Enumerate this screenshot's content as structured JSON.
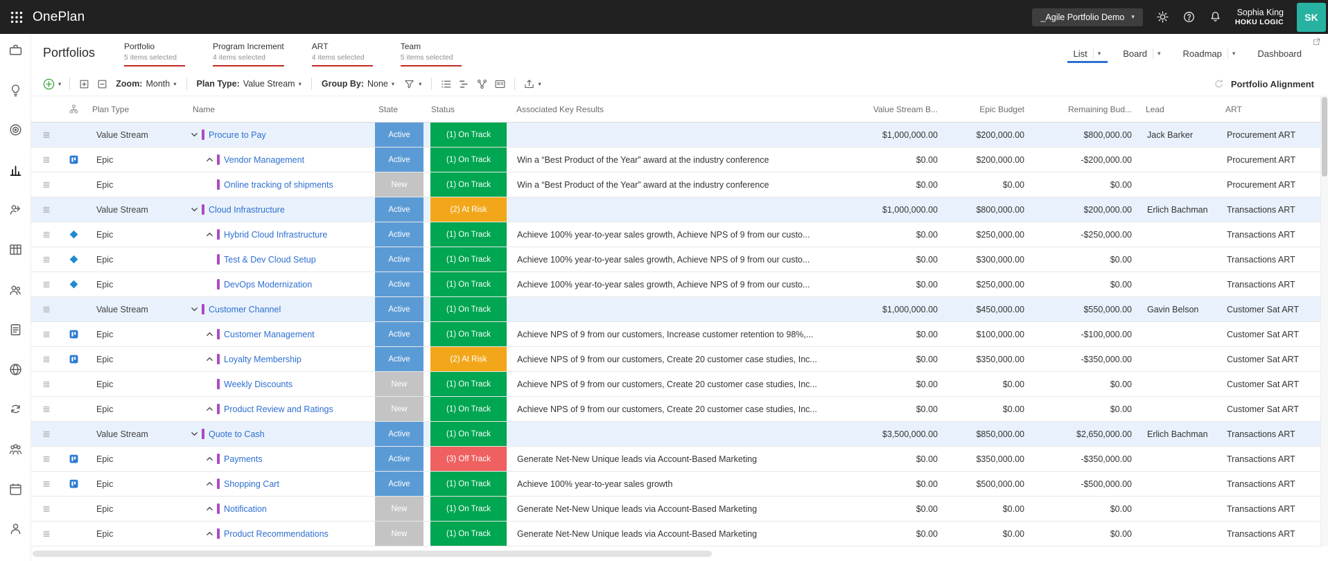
{
  "colors": {
    "topbar_bg": "#212121",
    "accent_blue": "#2e6fd0",
    "filter_underline_red": "#c12a23",
    "value_stream_row_bg": "#e9f2fc",
    "name_bar_purple": "#a94cc3",
    "avatar_teal": "#27b2a2"
  },
  "topbar": {
    "app_title": "OnePlan",
    "workspace_selector": "_Agile Portfolio Demo",
    "user_name": "Sophia King",
    "user_org": "HOKU LOGIC",
    "avatar_initials": "SK"
  },
  "sidebar": {
    "items": [
      {
        "id": "portfolios",
        "icon": "briefcase",
        "active": false
      },
      {
        "id": "ideas",
        "icon": "bulb",
        "active": false
      },
      {
        "id": "goals",
        "icon": "target",
        "active": false
      },
      {
        "id": "insights",
        "icon": "chart",
        "active": true
      },
      {
        "id": "resources",
        "icon": "peopleshare",
        "active": false
      },
      {
        "id": "grid",
        "icon": "table",
        "active": false
      },
      {
        "id": "teams",
        "icon": "people",
        "active": false
      },
      {
        "id": "backlog",
        "icon": "clipboard",
        "active": false
      },
      {
        "id": "network",
        "icon": "globe",
        "active": false
      },
      {
        "id": "processes",
        "icon": "sync",
        "active": false
      },
      {
        "id": "groups",
        "icon": "group",
        "active": false
      },
      {
        "id": "roadmap",
        "icon": "calendar",
        "active": false
      },
      {
        "id": "profile",
        "icon": "person",
        "active": false
      }
    ]
  },
  "page": {
    "title": "Portfolios",
    "filters": [
      {
        "label": "Portfolio",
        "sublabel": "5 items selected"
      },
      {
        "label": "Program Increment",
        "sublabel": "4 items selected"
      },
      {
        "label": "ART",
        "sublabel": "4 items selected"
      },
      {
        "label": "Team",
        "sublabel": "5 items selected"
      }
    ],
    "views": [
      {
        "label": "List",
        "caret": true,
        "active": true
      },
      {
        "label": "Board",
        "caret": true,
        "active": false
      },
      {
        "label": "Roadmap",
        "caret": true,
        "active": false
      },
      {
        "label": "Dashboard",
        "caret": false,
        "active": false
      }
    ]
  },
  "toolbar": {
    "zoom": {
      "label": "Zoom:",
      "value": "Month"
    },
    "plan_type": {
      "label": "Plan Type:",
      "value": "Value Stream"
    },
    "group_by": {
      "label": "Group By:",
      "value": "None"
    },
    "right_text": "Portfolio Alignment"
  },
  "table": {
    "columns": [
      "Plan Type",
      "Name",
      "State",
      "Status",
      "Associated Key Results",
      "Value Stream B...",
      "Epic Budget",
      "Remaining Bud...",
      "Lead",
      "ART"
    ],
    "state_colors": {
      "Active": "#5b9bd5",
      "New": "#c4c4c4"
    },
    "status_colors": {
      "(1) On Track": "#00a651",
      "(2) At Risk": "#f2a71b",
      "(3) Off Track": "#ee6160"
    },
    "rows": [
      {
        "type": "Value Stream",
        "integration": "",
        "caret": "down",
        "name": "Procure to Pay",
        "state": "Active",
        "status": "(1) On Track",
        "key_results": "",
        "value_stream_budget": "$1,000,000.00",
        "epic_budget": "$200,000.00",
        "remaining_budget": "$800,000.00",
        "lead": "Jack Barker",
        "art": "Procurement ART"
      },
      {
        "type": "Epic",
        "integration": "jira",
        "caret": "up",
        "name": "Vendor Management",
        "state": "Active",
        "status": "(1) On Track",
        "key_results": "Win a “Best Product of the Year” award at the industry conference",
        "value_stream_budget": "$0.00",
        "epic_budget": "$200,000.00",
        "remaining_budget": "-$200,000.00",
        "lead": "",
        "art": "Procurement ART"
      },
      {
        "type": "Epic",
        "integration": "",
        "caret": "",
        "name": "Online tracking of shipments",
        "state": "New",
        "status": "(1) On Track",
        "key_results": "Win a “Best Product of the Year” award at the industry conference",
        "value_stream_budget": "$0.00",
        "epic_budget": "$0.00",
        "remaining_budget": "$0.00",
        "lead": "",
        "art": "Procurement ART"
      },
      {
        "type": "Value Stream",
        "integration": "",
        "caret": "down",
        "name": "Cloud Infrastructure",
        "state": "Active",
        "status": "(2) At Risk",
        "key_results": "",
        "value_stream_budget": "$1,000,000.00",
        "epic_budget": "$800,000.00",
        "remaining_budget": "$200,000.00",
        "lead": "Erlich Bachman",
        "art": "Transactions ART"
      },
      {
        "type": "Epic",
        "integration": "azure",
        "caret": "up",
        "name": "Hybrid Cloud Infrastructure",
        "state": "Active",
        "status": "(1) On Track",
        "key_results": "Achieve 100% year-to-year sales growth, Achieve NPS of 9 from our custo...",
        "value_stream_budget": "$0.00",
        "epic_budget": "$250,000.00",
        "remaining_budget": "-$250,000.00",
        "lead": "",
        "art": "Transactions ART"
      },
      {
        "type": "Epic",
        "integration": "azure",
        "caret": "",
        "name": "Test & Dev Cloud Setup",
        "state": "Active",
        "status": "(1) On Track",
        "key_results": "Achieve 100% year-to-year sales growth, Achieve NPS of 9 from our custo...",
        "value_stream_budget": "$0.00",
        "epic_budget": "$300,000.00",
        "remaining_budget": "$0.00",
        "lead": "",
        "art": "Transactions ART"
      },
      {
        "type": "Epic",
        "integration": "azure",
        "caret": "",
        "name": "DevOps Modernization",
        "state": "Active",
        "status": "(1) On Track",
        "key_results": "Achieve 100% year-to-year sales growth, Achieve NPS of 9 from our custo...",
        "value_stream_budget": "$0.00",
        "epic_budget": "$250,000.00",
        "remaining_budget": "$0.00",
        "lead": "",
        "art": "Transactions ART"
      },
      {
        "type": "Value Stream",
        "integration": "",
        "caret": "down",
        "name": "Customer Channel",
        "state": "Active",
        "status": "(1) On Track",
        "key_results": "",
        "value_stream_budget": "$1,000,000.00",
        "epic_budget": "$450,000.00",
        "remaining_budget": "$550,000.00",
        "lead": "Gavin Belson",
        "art": "Customer Sat ART"
      },
      {
        "type": "Epic",
        "integration": "jira",
        "caret": "up",
        "name": "Customer Management",
        "state": "Active",
        "status": "(1) On Track",
        "key_results": "Achieve NPS of 9 from our customers, Increase customer retention to 98%,...",
        "value_stream_budget": "$0.00",
        "epic_budget": "$100,000.00",
        "remaining_budget": "-$100,000.00",
        "lead": "",
        "art": "Customer Sat ART"
      },
      {
        "type": "Epic",
        "integration": "jira",
        "caret": "up",
        "name": "Loyalty Membership",
        "state": "Active",
        "status": "(2) At Risk",
        "key_results": "Achieve NPS of 9 from our customers, Create 20 customer case studies, Inc...",
        "value_stream_budget": "$0.00",
        "epic_budget": "$350,000.00",
        "remaining_budget": "-$350,000.00",
        "lead": "",
        "art": "Customer Sat ART"
      },
      {
        "type": "Epic",
        "integration": "",
        "caret": "",
        "name": "Weekly Discounts",
        "state": "New",
        "status": "(1) On Track",
        "key_results": "Achieve NPS of 9 from our customers, Create 20 customer case studies, Inc...",
        "value_stream_budget": "$0.00",
        "epic_budget": "$0.00",
        "remaining_budget": "$0.00",
        "lead": "",
        "art": "Customer Sat ART"
      },
      {
        "type": "Epic",
        "integration": "",
        "caret": "up",
        "name": "Product Review and Ratings",
        "state": "New",
        "status": "(1) On Track",
        "key_results": "Achieve NPS of 9 from our customers, Create 20 customer case studies, Inc...",
        "value_stream_budget": "$0.00",
        "epic_budget": "$0.00",
        "remaining_budget": "$0.00",
        "lead": "",
        "art": "Customer Sat ART"
      },
      {
        "type": "Value Stream",
        "integration": "",
        "caret": "down",
        "name": "Quote to Cash",
        "state": "Active",
        "status": "(1) On Track",
        "key_results": "",
        "value_stream_budget": "$3,500,000.00",
        "epic_budget": "$850,000.00",
        "remaining_budget": "$2,650,000.00",
        "lead": "Erlich Bachman",
        "art": "Transactions ART"
      },
      {
        "type": "Epic",
        "integration": "jira",
        "caret": "up",
        "name": "Payments",
        "state": "Active",
        "status": "(3) Off Track",
        "key_results": "Generate Net-New Unique leads via Account-Based Marketing",
        "value_stream_budget": "$0.00",
        "epic_budget": "$350,000.00",
        "remaining_budget": "-$350,000.00",
        "lead": "",
        "art": "Transactions ART"
      },
      {
        "type": "Epic",
        "integration": "jira",
        "caret": "up",
        "name": "Shopping Cart",
        "state": "Active",
        "status": "(1) On Track",
        "key_results": "Achieve 100% year-to-year sales growth",
        "value_stream_budget": "$0.00",
        "epic_budget": "$500,000.00",
        "remaining_budget": "-$500,000.00",
        "lead": "",
        "art": "Transactions ART"
      },
      {
        "type": "Epic",
        "integration": "",
        "caret": "up",
        "name": "Notification",
        "state": "New",
        "status": "(1) On Track",
        "key_results": "Generate Net-New Unique leads via Account-Based Marketing",
        "value_stream_budget": "$0.00",
        "epic_budget": "$0.00",
        "remaining_budget": "$0.00",
        "lead": "",
        "art": "Transactions ART"
      },
      {
        "type": "Epic",
        "integration": "",
        "caret": "up",
        "name": "Product Recommendations",
        "state": "New",
        "status": "(1) On Track",
        "key_results": "Generate Net-New Unique leads via Account-Based Marketing",
        "value_stream_budget": "$0.00",
        "epic_budget": "$0.00",
        "remaining_budget": "$0.00",
        "lead": "",
        "art": "Transactions ART"
      }
    ]
  }
}
